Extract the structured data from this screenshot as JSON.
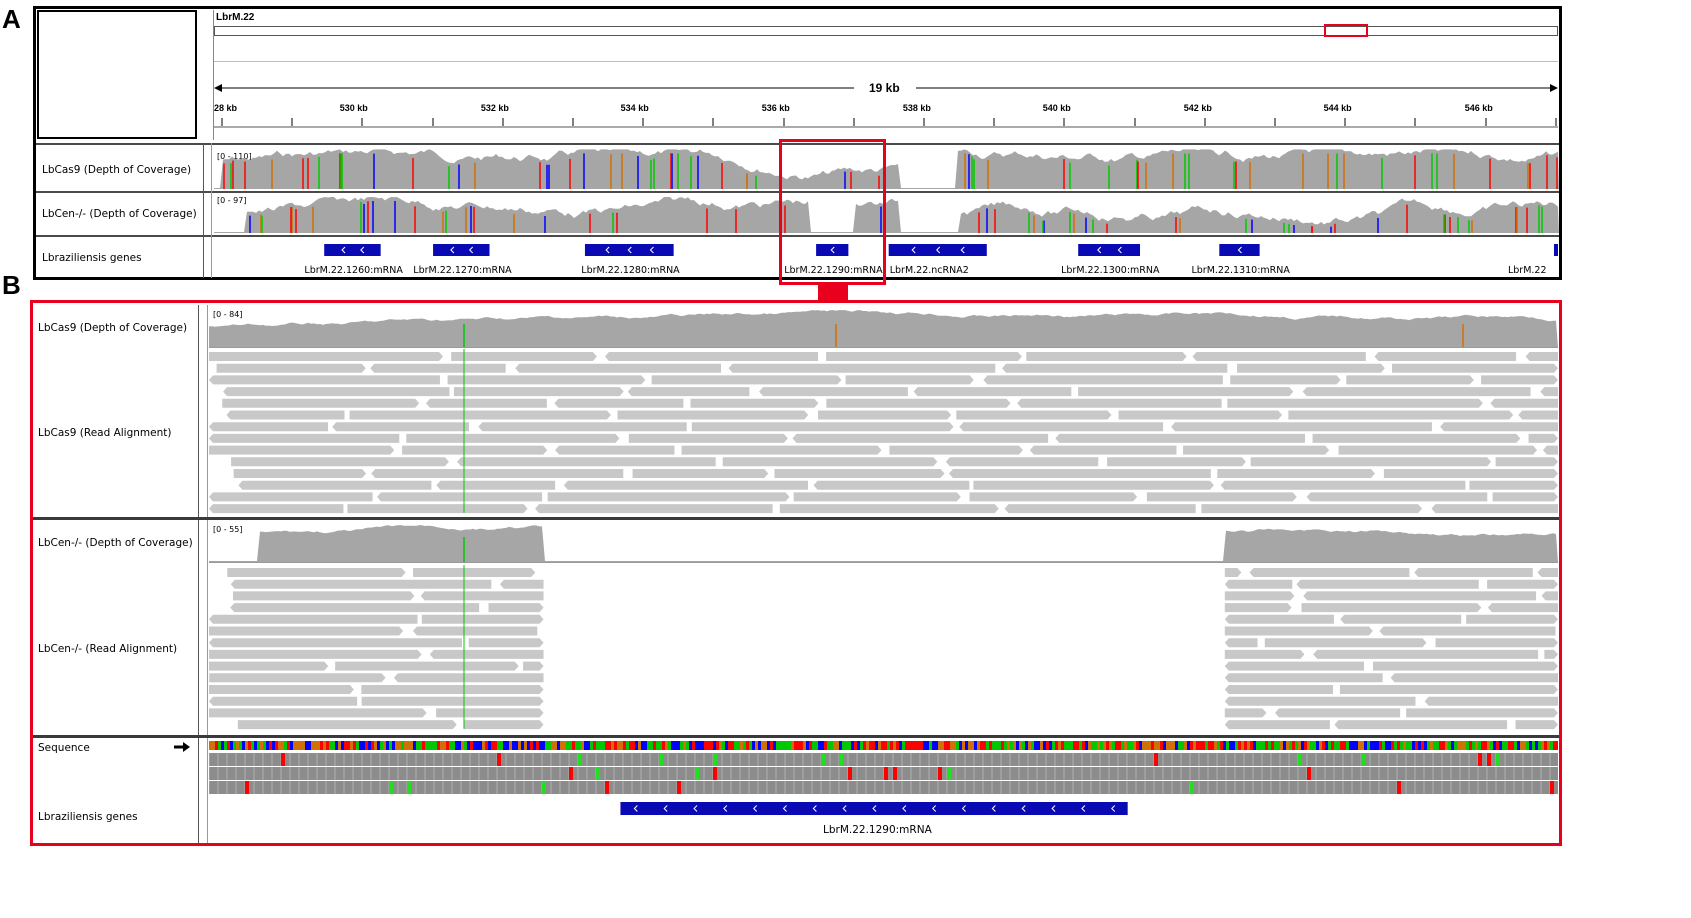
{
  "panels": {
    "a": {
      "letter": "A",
      "chromosome": "LbrM.22",
      "region_span": "19 kb",
      "ruler_ticks": [
        {
          "label": "28 kb",
          "frac": 0.0
        },
        {
          "label": "530 kb",
          "frac": 0.104
        },
        {
          "label": "532 kb",
          "frac": 0.209
        },
        {
          "label": "534 kb",
          "frac": 0.313
        },
        {
          "label": "536 kb",
          "frac": 0.418
        },
        {
          "label": "538 kb",
          "frac": 0.523
        },
        {
          "label": "540 kb",
          "frac": 0.627
        },
        {
          "label": "542 kb",
          "frac": 0.732
        },
        {
          "label": "544 kb",
          "frac": 0.836
        },
        {
          "label": "546 kb",
          "frac": 0.941
        }
      ],
      "tracks": [
        {
          "name": "LbCas9 (Depth of Coverage)",
          "range": "[0 - 110]"
        },
        {
          "name": "LbCen-/- (Depth of Coverage)",
          "range": "[0 - 97]"
        },
        {
          "name": "Lbraziliensis genes"
        }
      ],
      "genes": [
        {
          "label": "LbrM.22.1260:mRNA",
          "start": 0.082,
          "end": 0.124,
          "chevrons": 2
        },
        {
          "label": "LbrM.22.1270:mRNA",
          "start": 0.163,
          "end": 0.205,
          "chevrons": 2
        },
        {
          "label": "LbrM.22.1280:mRNA",
          "start": 0.276,
          "end": 0.342,
          "chevrons": 3
        },
        {
          "label": "LbrM.22.1290:mRNA",
          "start": 0.448,
          "end": 0.472,
          "chevrons": 1
        },
        {
          "label": "LbrM.22.ncRNA2",
          "start": 0.502,
          "end": 0.575,
          "chevrons": 3
        },
        {
          "label": "LbrM.22.1300:mRNA",
          "start": 0.643,
          "end": 0.689,
          "chevrons": 2
        },
        {
          "label": "LbrM.22.1310:mRNA",
          "start": 0.748,
          "end": 0.778,
          "chevrons": 1
        },
        {
          "label": "LbrM.22",
          "start": 0.997,
          "end": 1.0,
          "chevrons": 0
        }
      ]
    },
    "b": {
      "letter": "B",
      "tracks": [
        {
          "name": "LbCas9 (Depth of Coverage)",
          "range": "[0 - 84]"
        },
        {
          "name": "LbCas9 (Read Alignment)"
        },
        {
          "name": "LbCen-/- (Depth of Coverage)",
          "range": "[0 - 55]"
        },
        {
          "name": "LbCen-/- (Read Alignment)"
        },
        {
          "name": "Sequence"
        },
        {
          "name": "Lbraziliensis genes"
        }
      ],
      "gene": {
        "label": "LbrM.22.1290:mRNA",
        "start": 0.305,
        "end": 0.681,
        "chevrons": 17
      },
      "deletion": {
        "start": 0.248,
        "end": 0.753
      }
    }
  },
  "colors": {
    "frame": "#000000",
    "highlight": "#e8001c",
    "coverage": "#a6a6a6",
    "read": "#c8c8c8",
    "gene": "#0a0ab4",
    "mismatch_a": "#00c800",
    "mismatch_c": "#0000ff",
    "mismatch_g": "#d17105",
    "mismatch_t": "#ff0000"
  }
}
